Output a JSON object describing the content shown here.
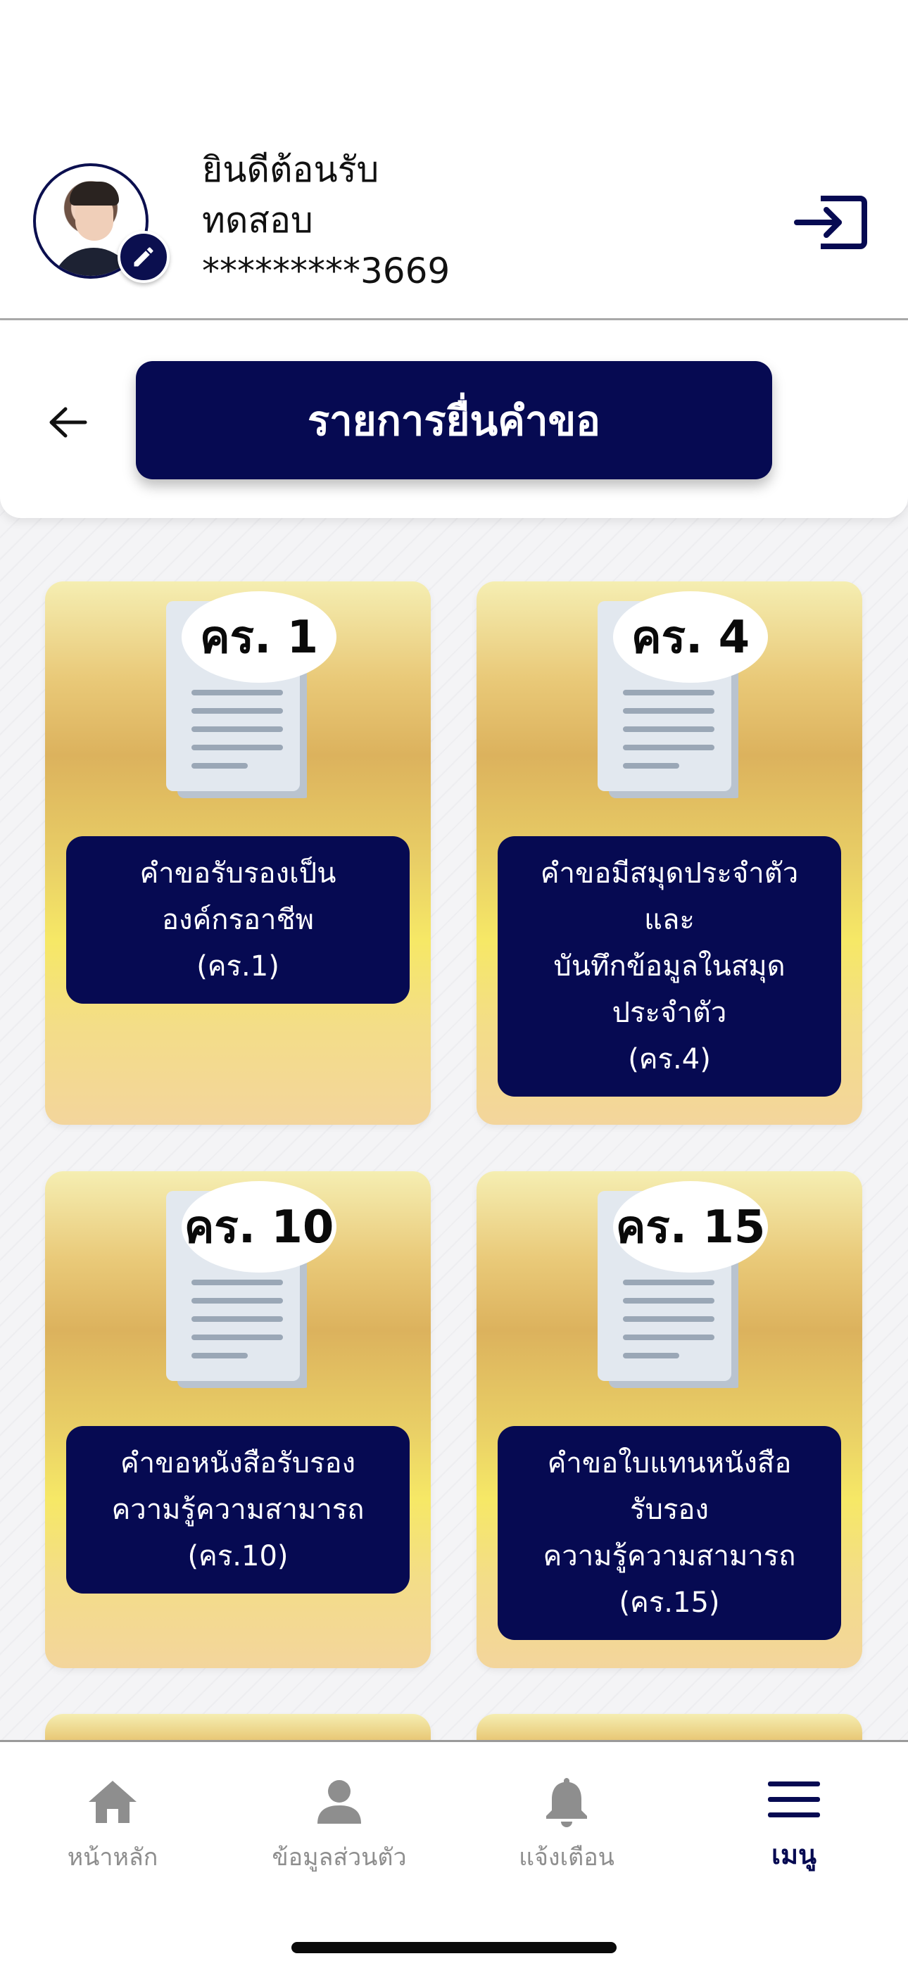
{
  "header": {
    "welcome_line": "ยินดีต้อนรับ",
    "user_name": "ทดสอบ",
    "masked_id": "*********3669"
  },
  "title_bar": {
    "title": "รายการยื่นคำขอ"
  },
  "cards": [
    {
      "code": "คร. 1",
      "description_lines": [
        "คำขอรับรองเป็น",
        "องค์กรอาชีพ",
        "(คร.1)"
      ]
    },
    {
      "code": "คร. 4",
      "description_lines": [
        "คำขอมีสมุดประจำตัว",
        "และ",
        "บันทึกข้อมูลในสมุด",
        "ประจำตัว",
        "(คร.4)"
      ]
    },
    {
      "code": "คร. 10",
      "description_lines": [
        "คำขอหนังสือรับรอง",
        "ความรู้ความสามารถ",
        "(คร.10)"
      ]
    },
    {
      "code": "คร. 15",
      "description_lines": [
        "คำขอใบแทนหนังสือ",
        "รับรอง",
        "ความรู้ความสามารถ",
        "(คร.15)"
      ]
    }
  ],
  "bottom_nav": {
    "items": [
      {
        "label": "หน้าหลัก",
        "icon": "home-icon",
        "active": false
      },
      {
        "label": "ข้อมูลส่วนตัว",
        "icon": "person-icon",
        "active": false
      },
      {
        "label": "แจ้งเตือน",
        "icon": "bell-icon",
        "active": false
      },
      {
        "label": "เมนู",
        "icon": "menu-icon",
        "active": true
      }
    ]
  },
  "colors": {
    "primary": "#060a52",
    "nav_inactive": "#8e8e8e",
    "card_gold": "#e9cf66"
  }
}
